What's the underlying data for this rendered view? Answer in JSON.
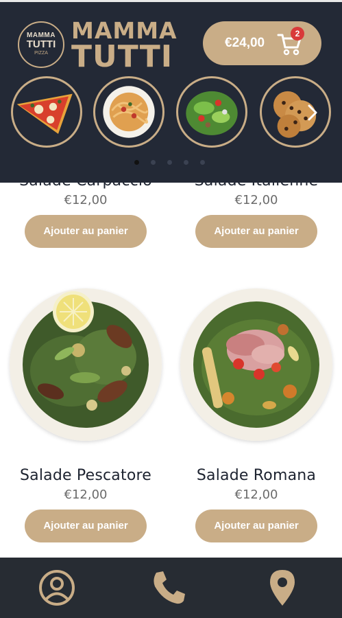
{
  "header": {
    "logo_line1": "MAMMA",
    "logo_line2": "TUTTI",
    "logo_line3": "PIZZA",
    "brand_line1": "MAMMA",
    "brand_line2": "TUTTI",
    "cart_total": "€24,00",
    "cart_count": "2"
  },
  "categories": [
    {
      "icon": "pizza-icon"
    },
    {
      "icon": "pasta-icon"
    },
    {
      "icon": "salad-icon"
    },
    {
      "icon": "cookies-icon"
    }
  ],
  "carousel": {
    "dot_count": 5,
    "active_index": 0
  },
  "products": [
    {
      "name": "Salade Carpaccio",
      "price": "€12,00",
      "button": "Ajouter au panier"
    },
    {
      "name": "Salade Italienne",
      "price": "€12,00",
      "button": "Ajouter au panier"
    },
    {
      "name": "Salade Pescatore",
      "price": "€12,00",
      "button": "Ajouter au panier"
    },
    {
      "name": "Salade Romana",
      "price": "€12,00",
      "button": "Ajouter au panier"
    }
  ],
  "bottom_nav": [
    {
      "icon": "user-icon"
    },
    {
      "icon": "phone-icon"
    },
    {
      "icon": "location-icon"
    }
  ],
  "colors": {
    "header_bg": "#232936",
    "accent_gold": "#c9ad87",
    "badge_red": "#d93a3a",
    "bottom_bar_bg": "#272c33"
  }
}
